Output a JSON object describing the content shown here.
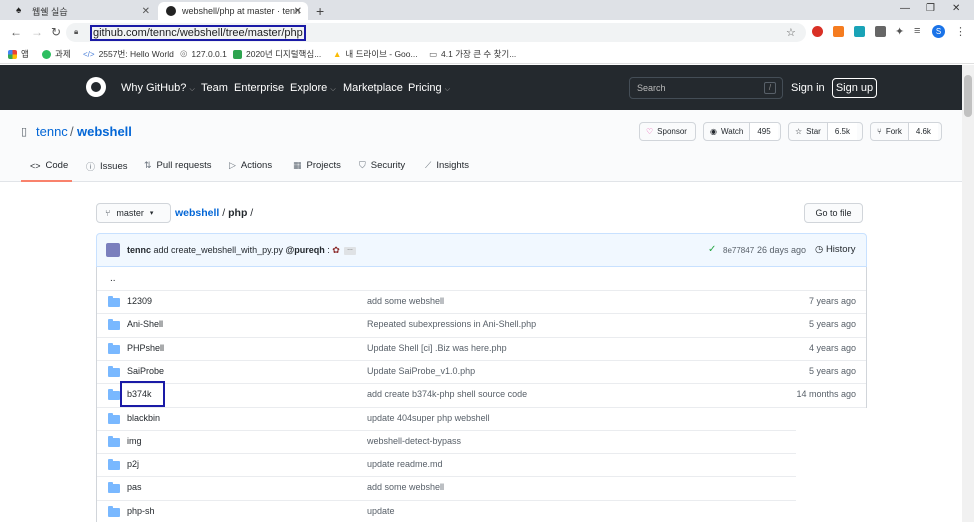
{
  "browser": {
    "tabs": [
      {
        "title": "웹쉘 실습",
        "active": false
      },
      {
        "title": "webshell/php at master · tennc",
        "active": true
      }
    ],
    "url": "github.com/tennc/webshell/tree/master/php",
    "bookmarks": [
      "앱",
      "과제",
      "2557번: Hello World",
      "127.0.0.1",
      "2020년 디지털핵심...",
      "내 드라이브 - Goo...",
      "4.1 가장 큰 수 찾기..."
    ],
    "profile_initial": "S"
  },
  "github": {
    "nav": [
      "Why GitHub?",
      "Team",
      "Enterprise",
      "Explore",
      "Marketplace",
      "Pricing"
    ],
    "search_placeholder": "Search",
    "search_key": "/",
    "sign_in": "Sign in",
    "sign_up": "Sign up"
  },
  "repo": {
    "owner": "tennc",
    "separator": "/",
    "name": "webshell",
    "sponsor_label": "Sponsor",
    "watch_label": "Watch",
    "watch_count": "495",
    "star_label": "Star",
    "star_count": "6.5k",
    "fork_label": "Fork",
    "fork_count": "4.6k",
    "tabs": [
      "Code",
      "Issues",
      "Pull requests",
      "Actions",
      "Projects",
      "Security",
      "Insights"
    ],
    "active_tab": "Code"
  },
  "browser_view": {
    "branch": "master",
    "breadcrumb_root": "webshell",
    "breadcrumb_dir": "php",
    "breadcrumb_sep": "/",
    "goto_file": "Go to file",
    "commit": {
      "author": "tennc",
      "message": "add create_webshell_with_py.py",
      "coauthor": "@pureqh",
      "sha": "8e77847",
      "age": "26 days ago",
      "history": "History"
    },
    "parent_dir": "..",
    "files": [
      {
        "name": "12309",
        "message": "add some webshell",
        "age": "7 years ago"
      },
      {
        "name": "Ani-Shell",
        "message": "Repeated subexpressions in Ani-Shell.php",
        "age": "5 years ago"
      },
      {
        "name": "PHPshell",
        "message": "Update Shell [ci] .Biz was here.php",
        "age": "4 years ago"
      },
      {
        "name": "SaiProbe",
        "message": "Update SaiProbe_v1.0.php",
        "age": "5 years ago"
      },
      {
        "name": "b374k",
        "message": "add create b374k-php shell source code",
        "age": "14 months ago"
      },
      {
        "name": "blackbin",
        "message": "update 404super php webshell",
        "age": ""
      },
      {
        "name": "img",
        "message": "webshell-detect-bypass",
        "age": ""
      },
      {
        "name": "p2j",
        "message": "update readme.md",
        "age": ""
      },
      {
        "name": "pas",
        "message": "add some webshell",
        "age": ""
      },
      {
        "name": "php-sh",
        "message": "update",
        "age": ""
      }
    ]
  },
  "colors": {
    "gh_header": "#24292e",
    "link": "#0366d6",
    "folder": "#79b8ff",
    "highlight_box": "#1a1aa6",
    "tab_underline": "#f9826c"
  }
}
